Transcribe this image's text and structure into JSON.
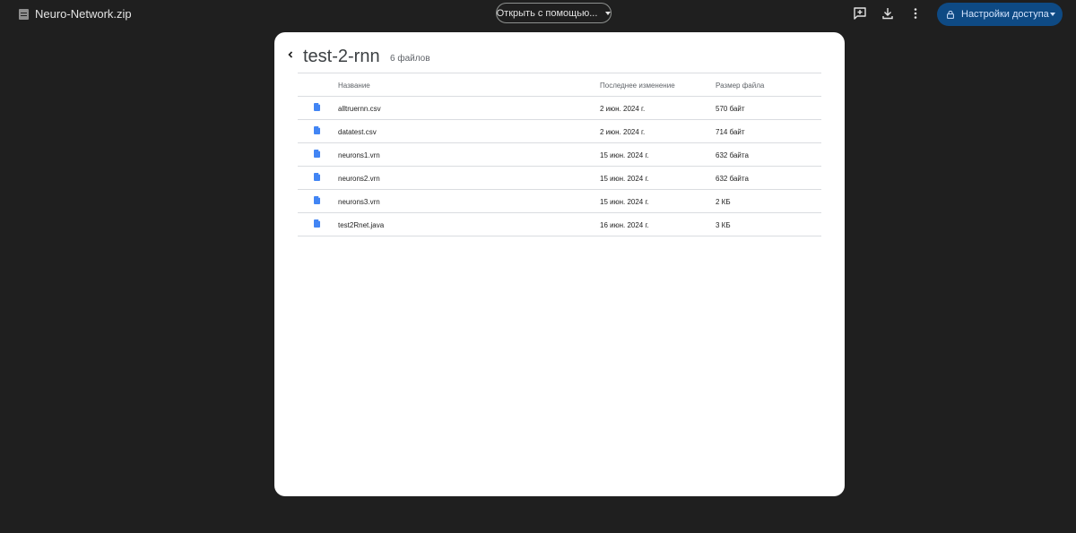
{
  "topbar": {
    "file_name": "Neuro-Network.zip",
    "file_icon": "archive-file-icon",
    "open_with_label": "Открыть с помощью...",
    "actions": [
      {
        "name": "add-comment-icon"
      },
      {
        "name": "download-icon"
      },
      {
        "name": "more-vert-icon"
      }
    ],
    "share_label": "Настройки доступа",
    "share_icon": "lock-icon",
    "share_color": "#0e4a84"
  },
  "panel": {
    "folder_name": "test-2-rnn",
    "file_count": "6 файлов",
    "columns": {
      "name": "Название",
      "modified": "Последнее изменение",
      "size": "Размер файла"
    },
    "files": [
      {
        "name": "alltruernn.csv",
        "modified": "2 июн. 2024 г.",
        "size": "570 байт"
      },
      {
        "name": "datatest.csv",
        "modified": "2 июн. 2024 г.",
        "size": "714 байт"
      },
      {
        "name": "neurons1.vrn",
        "modified": "15 июн. 2024 г.",
        "size": "632 байта"
      },
      {
        "name": "neurons2.vrn",
        "modified": "15 июн. 2024 г.",
        "size": "632 байта"
      },
      {
        "name": "neurons3.vrn",
        "modified": "15 июн. 2024 г.",
        "size": "2 КБ"
      },
      {
        "name": "test2Rnet.java",
        "modified": "16 июн. 2024 г.",
        "size": "3 КБ"
      }
    ],
    "file_icon": "document-icon",
    "file_icon_color": "#4285f4"
  }
}
